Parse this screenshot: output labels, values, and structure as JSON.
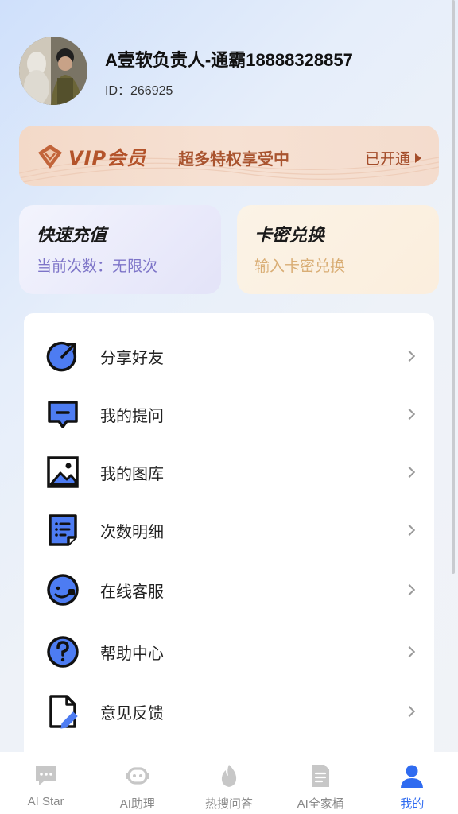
{
  "profile": {
    "name": "A壹软负责人-通霸18888328857",
    "id_text": "ID：266925"
  },
  "vip": {
    "title": "VIP会员",
    "subtitle": "超多特权享受中",
    "status": "已开通"
  },
  "cards": {
    "recharge": {
      "title": "快速充值",
      "subtitle": "当前次数：无限次"
    },
    "redeem": {
      "title": "卡密兑换",
      "subtitle": "输入卡密兑换"
    }
  },
  "menu": [
    {
      "label": "分享好友",
      "icon": "share-icon"
    },
    {
      "label": "我的提问",
      "icon": "message-icon"
    },
    {
      "label": "我的图库",
      "icon": "image-icon"
    },
    {
      "label": "次数明细",
      "icon": "list-document-icon"
    },
    {
      "label": "在线客服",
      "icon": "customer-service-icon"
    },
    {
      "label": "帮助中心",
      "icon": "help-icon"
    },
    {
      "label": "意见反馈",
      "icon": "feedback-icon"
    }
  ],
  "tabs": [
    {
      "label": "AI Star",
      "icon": "chat-icon",
      "active": false
    },
    {
      "label": "AI助理",
      "icon": "robot-icon",
      "active": false
    },
    {
      "label": "热搜问答",
      "icon": "fire-icon",
      "active": false
    },
    {
      "label": "AI全家桶",
      "icon": "document-icon",
      "active": false
    },
    {
      "label": "我的",
      "icon": "user-icon",
      "active": true
    }
  ],
  "colors": {
    "accent": "#2f6bf0",
    "vip_text": "#b4532a",
    "icon_blue": "#4d7cf2"
  }
}
